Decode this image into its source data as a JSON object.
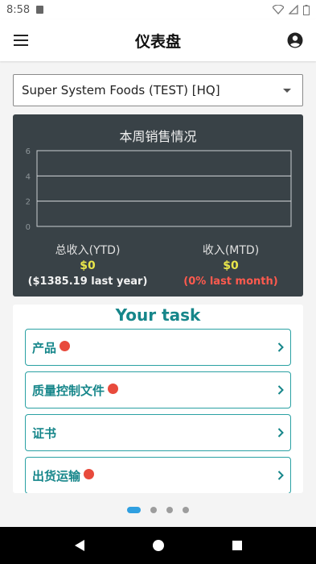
{
  "status_bar": {
    "time": "8:58"
  },
  "app_bar": {
    "title": "仪表盘"
  },
  "store_select": {
    "value": "Super System Foods (TEST) [HQ]"
  },
  "sales_card": {
    "title": "本周销售情况",
    "ytd": {
      "label": "总收入(YTD)",
      "value": "$0",
      "sub": "($1385.19 last year)"
    },
    "mtd": {
      "label": "收入(MTD)",
      "value": "$0",
      "sub": "(0% last month)"
    },
    "colors": {
      "background": "#394247",
      "value": "#e9e64a",
      "negative": "#ff5a4e"
    }
  },
  "chart_data": {
    "type": "line",
    "title": "",
    "xlabel": "",
    "ylabel": "",
    "ylim": [
      0,
      6
    ],
    "yticks": [
      "6",
      "4",
      "2",
      "0"
    ],
    "grid": true,
    "series": []
  },
  "task_card": {
    "title": "Your task",
    "items": [
      {
        "label": "产品",
        "badge": true
      },
      {
        "label": "质量控制文件",
        "badge": true
      },
      {
        "label": "证书",
        "badge": false
      },
      {
        "label": "出货运输",
        "badge": true
      }
    ]
  },
  "pager": {
    "pages": 4,
    "active": 0
  },
  "icons": {
    "menu": "menu-icon",
    "account": "account-circle-icon",
    "dropdown": "dropdown-caret-icon",
    "chevron": "chevron-right-icon",
    "back": "nav-back-icon",
    "home": "nav-home-icon",
    "recents": "nav-recents-icon"
  }
}
